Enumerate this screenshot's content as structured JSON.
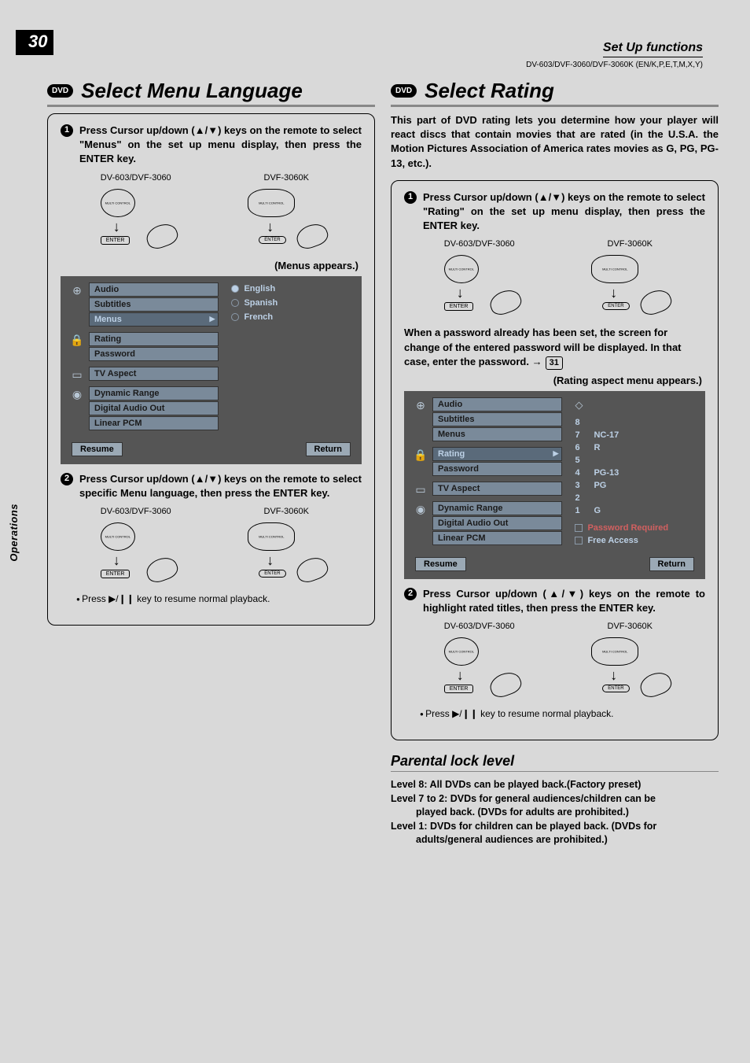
{
  "page_number": "30",
  "side_tab": "Operations",
  "header": {
    "section": "Set Up functions",
    "models": "DV-603/DVF-3060/DVF-3060K (EN/K,P,E,T,M,X,Y)"
  },
  "left": {
    "badge": "DVD",
    "title": "Select Menu Language",
    "step1": "Press Cursor up/down (▲/▼) keys on the remote to select \"Menus\" on the set up menu display, then press the ENTER key.",
    "remote_a_label": "DV-603/DVF-3060",
    "remote_b_label": "DVF-3060K",
    "enter_label": "ENTER",
    "appears": "(Menus appears.)",
    "menu": {
      "groups": [
        {
          "icon": "⊕",
          "items": [
            "Audio",
            "Subtitles",
            "Menus"
          ],
          "selected": "Menus"
        },
        {
          "icon": "🔒",
          "items": [
            "Rating",
            "Password"
          ]
        },
        {
          "icon": "▭",
          "items": [
            "TV Aspect"
          ]
        },
        {
          "icon": "◉",
          "items": [
            "Dynamic Range",
            "Digital Audio Out",
            "Linear PCM"
          ]
        }
      ],
      "options": [
        "English",
        "Spanish",
        "French"
      ],
      "selected_option": "English",
      "resume": "Resume",
      "return": "Return"
    },
    "step2": "Press Cursor up/down (▲/▼) keys on the remote to select specific Menu language, then press the ENTER key.",
    "resume_note": "Press ▶/❙❙ key to resume normal playback."
  },
  "right": {
    "badge": "DVD",
    "title": "Select Rating",
    "intro": "This part of DVD rating lets you determine how your player will react discs that contain movies that are rated (in the U.S.A. the Motion Pictures Association of America rates movies as G, PG, PG-13, etc.).",
    "step1": "Press Cursor up/down (▲/▼) keys on the remote to select \"Rating\" on the set up menu display, then press the ENTER key.",
    "remote_a_label": "DV-603/DVF-3060",
    "remote_b_label": "DVF-3060K",
    "enter_label": "ENTER",
    "password_note_a": "When a password already has been set, the screen for change of the entered password will be displayed. In that case, enter the password.",
    "password_ref_arrow": "→",
    "password_ref": "31",
    "appears": "(Rating aspect menu appears.)",
    "menu": {
      "groups": [
        {
          "icon": "⊕",
          "items": [
            "Audio",
            "Subtitles",
            "Menus"
          ]
        },
        {
          "icon": "🔒",
          "items": [
            "Rating",
            "Password"
          ],
          "selected": "Rating"
        },
        {
          "icon": "▭",
          "items": [
            "TV Aspect"
          ]
        },
        {
          "icon": "◉",
          "items": [
            "Dynamic Range",
            "Digital Audio Out",
            "Linear PCM"
          ]
        }
      ],
      "ratings": [
        {
          "n": "8",
          "label": ""
        },
        {
          "n": "7",
          "label": "NC-17"
        },
        {
          "n": "6",
          "label": "R"
        },
        {
          "n": "5",
          "label": ""
        },
        {
          "n": "4",
          "label": "PG-13"
        },
        {
          "n": "3",
          "label": "PG"
        },
        {
          "n": "2",
          "label": ""
        },
        {
          "n": "1",
          "label": "G"
        }
      ],
      "extra": [
        "Password Required",
        "Free Access"
      ],
      "resume": "Resume",
      "return": "Return"
    },
    "step2": "Press Cursor up/down (▲/▼) keys on the remote to highlight rated titles, then press the ENTER key.",
    "resume_note": "Press ▶/❙❙ key to resume normal playback.",
    "parental": {
      "title": "Parental lock level",
      "l8": "Level 8: All DVDs can be played back.(Factory preset)",
      "l72a": "Level 7 to 2: DVDs  for general audiences/children can be",
      "l72b": "played back. (DVDs for adults are prohibited.)",
      "l1a": "Level 1: DVDs for children can be played back. (DVDs for",
      "l1b": "adults/general audiences are prohibited.)"
    }
  }
}
